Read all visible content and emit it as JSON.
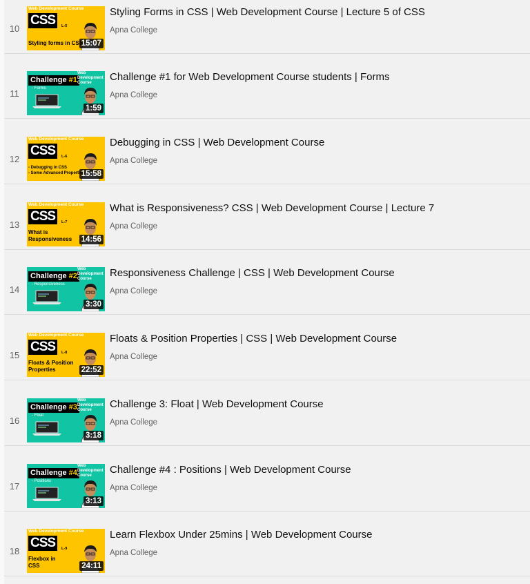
{
  "videos": [
    {
      "index": "10",
      "title": "Styling Forms in CSS | Web Development Course | Lecture 5 of CSS",
      "channel": "Apna College",
      "duration": "15:07",
      "thumb": {
        "style": "css",
        "banner": "Web Development Course",
        "lecture": "L-5",
        "caption": [
          "Styling forms in CSS"
        ]
      }
    },
    {
      "index": "11",
      "title": "Challenge #1 for Web Development Course students | Forms",
      "channel": "Apna College",
      "duration": "1:59",
      "thumb": {
        "style": "challenge",
        "challenge_word": "Challenge",
        "challenge_num": "#1",
        "topic": "- Forms",
        "side_label": "Web Development Course"
      }
    },
    {
      "index": "12",
      "title": "Debugging in CSS | Web Development Course",
      "channel": "Apna College",
      "duration": "15:58",
      "thumb": {
        "style": "css",
        "banner": "Web Development Course",
        "lecture": "L-6",
        "caption": [
          "- Debugging in CSS",
          "- Some Advanced Properties"
        ]
      }
    },
    {
      "index": "13",
      "title": "What is Responsiveness? CSS | Web Development Course | Lecture 7",
      "channel": "Apna College",
      "duration": "14:56",
      "thumb": {
        "style": "css",
        "banner": "Web Development Course",
        "lecture": "L-7",
        "caption": [
          "What is",
          "Responsiveness"
        ]
      }
    },
    {
      "index": "14",
      "title": "Responsiveness Challenge | CSS | Web Development Course",
      "channel": "Apna College",
      "duration": "3:30",
      "thumb": {
        "style": "challenge",
        "challenge_word": "Challenge",
        "challenge_num": "#2",
        "topic": "- Responsiveness",
        "side_label": "Web Development Course"
      }
    },
    {
      "index": "15",
      "title": "Floats & Position Properties | CSS | Web Development Course",
      "channel": "Apna College",
      "duration": "22:52",
      "thumb": {
        "style": "css",
        "banner": "Web Development Course",
        "lecture": "L-8",
        "caption": [
          "Floats & Position",
          "Properties"
        ]
      }
    },
    {
      "index": "16",
      "title": "Challenge 3: Float | Web Development Course",
      "channel": "Apna College",
      "duration": "3:18",
      "thumb": {
        "style": "challenge",
        "challenge_word": "Challenge",
        "challenge_num": "#3",
        "topic": "- Float",
        "side_label": "Web Development Course"
      }
    },
    {
      "index": "17",
      "title": "Challenge #4 : Positions | Web Development Course",
      "channel": "Apna College",
      "duration": "3:13",
      "thumb": {
        "style": "challenge",
        "challenge_word": "Challenge",
        "challenge_num": "#4",
        "topic": "- Positions",
        "side_label": "Web Development Course"
      }
    },
    {
      "index": "18",
      "title": "Learn Flexbox Under 25mins | Web Development Course",
      "channel": "Apna College",
      "duration": "24:11",
      "thumb": {
        "style": "css",
        "banner": "Web Development Course",
        "lecture": "L-9",
        "caption": [
          "Flexbox in",
          "CSS"
        ]
      }
    }
  ]
}
